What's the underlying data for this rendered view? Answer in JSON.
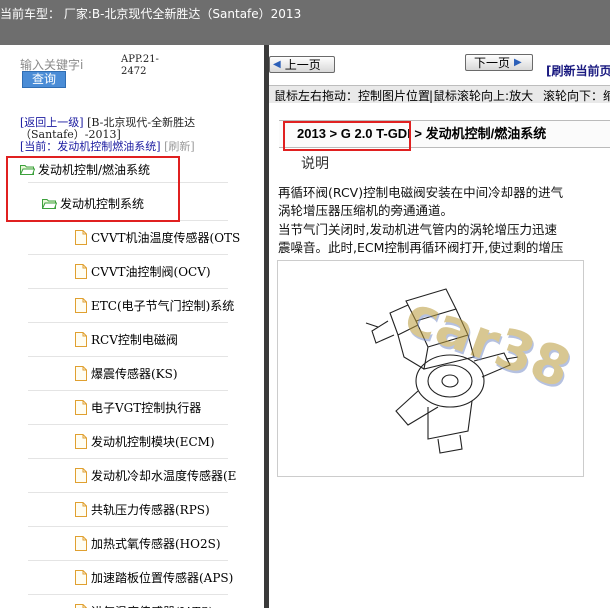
{
  "titlebar": {
    "text": "当前车型：  厂家:B-北京现代全新胜达（Santafe）2013"
  },
  "left": {
    "search_placeholder": "输入关键字i",
    "app_version": "APP.21-\n2472",
    "query_button": "查询",
    "breadcrumb": {
      "back": "[返回上一级]",
      "path": "[B-北京现代-全新胜达（Santafe）-2013]",
      "current": "[当前：发动机控制燃油系统]",
      "refresh": "[刷新]"
    },
    "tree": {
      "level1": "发动机控制/燃油系统",
      "level2": "发动机控制系统",
      "items": [
        "CVVT机油温度传感器(OTS",
        "CVVT油控制阀(OCV)",
        "ETC(电子节气门控制)系统",
        "RCV控制电磁阀",
        "爆震传感器(KS)",
        "电子VGT控制执行器",
        "发动机控制模块(ECM)",
        "发动机冷却水温度传感器(E",
        "共轨压力传感器(RPS)",
        "加热式氧传感器(HO2S)",
        "加速踏板位置传感器(APS)",
        "进气温度传感器(IATS)"
      ]
    }
  },
  "right": {
    "prev_button": "上一页",
    "next_button": "下一页",
    "refresh_label": "[刷新当前页",
    "hints": [
      "鼠标左右拖动：控制图片位置",
      "|鼠标滚轮向上:放大",
      "滚轮向下：缩"
    ],
    "heading": "2013 > G 2.0 T-GDI > 发动机控制/燃油系统",
    "section": "说明",
    "paragraphs": [
      "再循环阀(RCV)控制电磁阀安装在中间冷却器的进气",
      "涡轮增压器压缩机的旁通通道。",
      "当节气门关闭时,发动机进气管内的涡轮增压力迅速",
      "震噪音。此时,ECM控制再循环阀打开,使过剩的增压"
    ],
    "watermark": "car38"
  },
  "colors": {
    "titlebar_bg": "#6e6e6e",
    "highlight_red": "#e02020",
    "query_blue": "#4a8cd6",
    "link_blue": "#1a1aa0"
  }
}
